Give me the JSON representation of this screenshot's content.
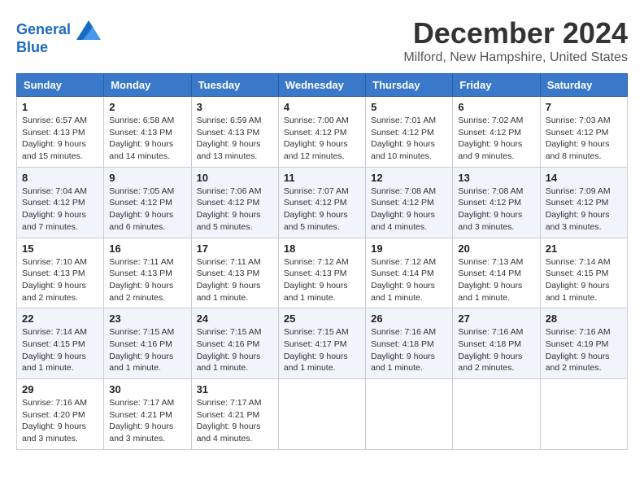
{
  "logo": {
    "line1": "General",
    "line2": "Blue"
  },
  "title": "December 2024",
  "location": "Milford, New Hampshire, United States",
  "days_of_week": [
    "Sunday",
    "Monday",
    "Tuesday",
    "Wednesday",
    "Thursday",
    "Friday",
    "Saturday"
  ],
  "weeks": [
    [
      {
        "day": "1",
        "sunrise": "6:57 AM",
        "sunset": "4:13 PM",
        "daylight": "9 hours and 15 minutes."
      },
      {
        "day": "2",
        "sunrise": "6:58 AM",
        "sunset": "4:13 PM",
        "daylight": "9 hours and 14 minutes."
      },
      {
        "day": "3",
        "sunrise": "6:59 AM",
        "sunset": "4:13 PM",
        "daylight": "9 hours and 13 minutes."
      },
      {
        "day": "4",
        "sunrise": "7:00 AM",
        "sunset": "4:12 PM",
        "daylight": "9 hours and 12 minutes."
      },
      {
        "day": "5",
        "sunrise": "7:01 AM",
        "sunset": "4:12 PM",
        "daylight": "9 hours and 10 minutes."
      },
      {
        "day": "6",
        "sunrise": "7:02 AM",
        "sunset": "4:12 PM",
        "daylight": "9 hours and 9 minutes."
      },
      {
        "day": "7",
        "sunrise": "7:03 AM",
        "sunset": "4:12 PM",
        "daylight": "9 hours and 8 minutes."
      }
    ],
    [
      {
        "day": "8",
        "sunrise": "7:04 AM",
        "sunset": "4:12 PM",
        "daylight": "9 hours and 7 minutes."
      },
      {
        "day": "9",
        "sunrise": "7:05 AM",
        "sunset": "4:12 PM",
        "daylight": "9 hours and 6 minutes."
      },
      {
        "day": "10",
        "sunrise": "7:06 AM",
        "sunset": "4:12 PM",
        "daylight": "9 hours and 5 minutes."
      },
      {
        "day": "11",
        "sunrise": "7:07 AM",
        "sunset": "4:12 PM",
        "daylight": "9 hours and 5 minutes."
      },
      {
        "day": "12",
        "sunrise": "7:08 AM",
        "sunset": "4:12 PM",
        "daylight": "9 hours and 4 minutes."
      },
      {
        "day": "13",
        "sunrise": "7:08 AM",
        "sunset": "4:12 PM",
        "daylight": "9 hours and 3 minutes."
      },
      {
        "day": "14",
        "sunrise": "7:09 AM",
        "sunset": "4:12 PM",
        "daylight": "9 hours and 3 minutes."
      }
    ],
    [
      {
        "day": "15",
        "sunrise": "7:10 AM",
        "sunset": "4:13 PM",
        "daylight": "9 hours and 2 minutes."
      },
      {
        "day": "16",
        "sunrise": "7:11 AM",
        "sunset": "4:13 PM",
        "daylight": "9 hours and 2 minutes."
      },
      {
        "day": "17",
        "sunrise": "7:11 AM",
        "sunset": "4:13 PM",
        "daylight": "9 hours and 1 minute."
      },
      {
        "day": "18",
        "sunrise": "7:12 AM",
        "sunset": "4:13 PM",
        "daylight": "9 hours and 1 minute."
      },
      {
        "day": "19",
        "sunrise": "7:12 AM",
        "sunset": "4:14 PM",
        "daylight": "9 hours and 1 minute."
      },
      {
        "day": "20",
        "sunrise": "7:13 AM",
        "sunset": "4:14 PM",
        "daylight": "9 hours and 1 minute."
      },
      {
        "day": "21",
        "sunrise": "7:14 AM",
        "sunset": "4:15 PM",
        "daylight": "9 hours and 1 minute."
      }
    ],
    [
      {
        "day": "22",
        "sunrise": "7:14 AM",
        "sunset": "4:15 PM",
        "daylight": "9 hours and 1 minute."
      },
      {
        "day": "23",
        "sunrise": "7:15 AM",
        "sunset": "4:16 PM",
        "daylight": "9 hours and 1 minute."
      },
      {
        "day": "24",
        "sunrise": "7:15 AM",
        "sunset": "4:16 PM",
        "daylight": "9 hours and 1 minute."
      },
      {
        "day": "25",
        "sunrise": "7:15 AM",
        "sunset": "4:17 PM",
        "daylight": "9 hours and 1 minute."
      },
      {
        "day": "26",
        "sunrise": "7:16 AM",
        "sunset": "4:18 PM",
        "daylight": "9 hours and 1 minute."
      },
      {
        "day": "27",
        "sunrise": "7:16 AM",
        "sunset": "4:18 PM",
        "daylight": "9 hours and 2 minutes."
      },
      {
        "day": "28",
        "sunrise": "7:16 AM",
        "sunset": "4:19 PM",
        "daylight": "9 hours and 2 minutes."
      }
    ],
    [
      {
        "day": "29",
        "sunrise": "7:16 AM",
        "sunset": "4:20 PM",
        "daylight": "9 hours and 3 minutes."
      },
      {
        "day": "30",
        "sunrise": "7:17 AM",
        "sunset": "4:21 PM",
        "daylight": "9 hours and 3 minutes."
      },
      {
        "day": "31",
        "sunrise": "7:17 AM",
        "sunset": "4:21 PM",
        "daylight": "9 hours and 4 minutes."
      },
      null,
      null,
      null,
      null
    ]
  ]
}
